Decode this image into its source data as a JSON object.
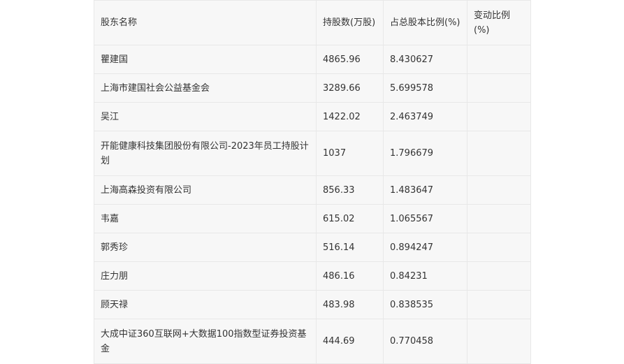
{
  "table": {
    "headers": [
      "股东名称",
      "持股数(万股)",
      "占总股本比例(%)",
      "变动比例(%)"
    ],
    "rows": [
      {
        "name": "瞿建国",
        "shares": "4865.96",
        "ratio": "8.430627",
        "change": ""
      },
      {
        "name": "上海市建国社会公益基金会",
        "shares": "3289.66",
        "ratio": "5.699578",
        "change": ""
      },
      {
        "name": "吴江",
        "shares": "1422.02",
        "ratio": "2.463749",
        "change": ""
      },
      {
        "name": "开能健康科技集团股份有限公司-2023年员工持股计划",
        "shares": "1037",
        "ratio": "1.796679",
        "change": ""
      },
      {
        "name": "上海高森投资有限公司",
        "shares": "856.33",
        "ratio": "1.483647",
        "change": ""
      },
      {
        "name": "韦嘉",
        "shares": "615.02",
        "ratio": "1.065567",
        "change": ""
      },
      {
        "name": "郭秀珍",
        "shares": "516.14",
        "ratio": "0.894247",
        "change": ""
      },
      {
        "name": "庄力朋",
        "shares": "486.16",
        "ratio": "0.84231",
        "change": ""
      },
      {
        "name": "顾天禄",
        "shares": "483.98",
        "ratio": "0.838535",
        "change": ""
      },
      {
        "name": "大成中证360互联网+大数据100指数型证券投资基金",
        "shares": "444.69",
        "ratio": "0.770458",
        "change": ""
      }
    ]
  }
}
